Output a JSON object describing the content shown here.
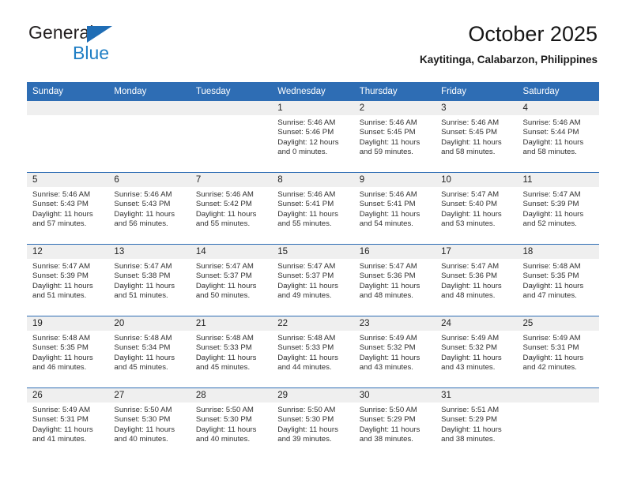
{
  "brand": {
    "name_part1": "General",
    "name_part2": "Blue",
    "triangle_icon": "blue-triangle-icon",
    "accent_color": "#1f7ec4"
  },
  "header": {
    "title": "October 2025",
    "subtitle": "Kaytitinga, Calabarzon, Philippines"
  },
  "theme": {
    "header_blue": "#2e6db4",
    "daynum_band": "#efefef",
    "text": "#222222"
  },
  "calendar": {
    "weekday_headers": [
      "Sunday",
      "Monday",
      "Tuesday",
      "Wednesday",
      "Thursday",
      "Friday",
      "Saturday"
    ],
    "weeks": [
      [
        {
          "day": "",
          "empty": true
        },
        {
          "day": "",
          "empty": true
        },
        {
          "day": "",
          "empty": true
        },
        {
          "day": "1",
          "sunrise": "Sunrise: 5:46 AM",
          "sunset": "Sunset: 5:46 PM",
          "daylight_1": "Daylight: 12 hours",
          "daylight_2": "and 0 minutes."
        },
        {
          "day": "2",
          "sunrise": "Sunrise: 5:46 AM",
          "sunset": "Sunset: 5:45 PM",
          "daylight_1": "Daylight: 11 hours",
          "daylight_2": "and 59 minutes."
        },
        {
          "day": "3",
          "sunrise": "Sunrise: 5:46 AM",
          "sunset": "Sunset: 5:45 PM",
          "daylight_1": "Daylight: 11 hours",
          "daylight_2": "and 58 minutes."
        },
        {
          "day": "4",
          "sunrise": "Sunrise: 5:46 AM",
          "sunset": "Sunset: 5:44 PM",
          "daylight_1": "Daylight: 11 hours",
          "daylight_2": "and 58 minutes."
        }
      ],
      [
        {
          "day": "5",
          "sunrise": "Sunrise: 5:46 AM",
          "sunset": "Sunset: 5:43 PM",
          "daylight_1": "Daylight: 11 hours",
          "daylight_2": "and 57 minutes."
        },
        {
          "day": "6",
          "sunrise": "Sunrise: 5:46 AM",
          "sunset": "Sunset: 5:43 PM",
          "daylight_1": "Daylight: 11 hours",
          "daylight_2": "and 56 minutes."
        },
        {
          "day": "7",
          "sunrise": "Sunrise: 5:46 AM",
          "sunset": "Sunset: 5:42 PM",
          "daylight_1": "Daylight: 11 hours",
          "daylight_2": "and 55 minutes."
        },
        {
          "day": "8",
          "sunrise": "Sunrise: 5:46 AM",
          "sunset": "Sunset: 5:41 PM",
          "daylight_1": "Daylight: 11 hours",
          "daylight_2": "and 55 minutes."
        },
        {
          "day": "9",
          "sunrise": "Sunrise: 5:46 AM",
          "sunset": "Sunset: 5:41 PM",
          "daylight_1": "Daylight: 11 hours",
          "daylight_2": "and 54 minutes."
        },
        {
          "day": "10",
          "sunrise": "Sunrise: 5:47 AM",
          "sunset": "Sunset: 5:40 PM",
          "daylight_1": "Daylight: 11 hours",
          "daylight_2": "and 53 minutes."
        },
        {
          "day": "11",
          "sunrise": "Sunrise: 5:47 AM",
          "sunset": "Sunset: 5:39 PM",
          "daylight_1": "Daylight: 11 hours",
          "daylight_2": "and 52 minutes."
        }
      ],
      [
        {
          "day": "12",
          "sunrise": "Sunrise: 5:47 AM",
          "sunset": "Sunset: 5:39 PM",
          "daylight_1": "Daylight: 11 hours",
          "daylight_2": "and 51 minutes."
        },
        {
          "day": "13",
          "sunrise": "Sunrise: 5:47 AM",
          "sunset": "Sunset: 5:38 PM",
          "daylight_1": "Daylight: 11 hours",
          "daylight_2": "and 51 minutes."
        },
        {
          "day": "14",
          "sunrise": "Sunrise: 5:47 AM",
          "sunset": "Sunset: 5:37 PM",
          "daylight_1": "Daylight: 11 hours",
          "daylight_2": "and 50 minutes."
        },
        {
          "day": "15",
          "sunrise": "Sunrise: 5:47 AM",
          "sunset": "Sunset: 5:37 PM",
          "daylight_1": "Daylight: 11 hours",
          "daylight_2": "and 49 minutes."
        },
        {
          "day": "16",
          "sunrise": "Sunrise: 5:47 AM",
          "sunset": "Sunset: 5:36 PM",
          "daylight_1": "Daylight: 11 hours",
          "daylight_2": "and 48 minutes."
        },
        {
          "day": "17",
          "sunrise": "Sunrise: 5:47 AM",
          "sunset": "Sunset: 5:36 PM",
          "daylight_1": "Daylight: 11 hours",
          "daylight_2": "and 48 minutes."
        },
        {
          "day": "18",
          "sunrise": "Sunrise: 5:48 AM",
          "sunset": "Sunset: 5:35 PM",
          "daylight_1": "Daylight: 11 hours",
          "daylight_2": "and 47 minutes."
        }
      ],
      [
        {
          "day": "19",
          "sunrise": "Sunrise: 5:48 AM",
          "sunset": "Sunset: 5:35 PM",
          "daylight_1": "Daylight: 11 hours",
          "daylight_2": "and 46 minutes."
        },
        {
          "day": "20",
          "sunrise": "Sunrise: 5:48 AM",
          "sunset": "Sunset: 5:34 PM",
          "daylight_1": "Daylight: 11 hours",
          "daylight_2": "and 45 minutes."
        },
        {
          "day": "21",
          "sunrise": "Sunrise: 5:48 AM",
          "sunset": "Sunset: 5:33 PM",
          "daylight_1": "Daylight: 11 hours",
          "daylight_2": "and 45 minutes."
        },
        {
          "day": "22",
          "sunrise": "Sunrise: 5:48 AM",
          "sunset": "Sunset: 5:33 PM",
          "daylight_1": "Daylight: 11 hours",
          "daylight_2": "and 44 minutes."
        },
        {
          "day": "23",
          "sunrise": "Sunrise: 5:49 AM",
          "sunset": "Sunset: 5:32 PM",
          "daylight_1": "Daylight: 11 hours",
          "daylight_2": "and 43 minutes."
        },
        {
          "day": "24",
          "sunrise": "Sunrise: 5:49 AM",
          "sunset": "Sunset: 5:32 PM",
          "daylight_1": "Daylight: 11 hours",
          "daylight_2": "and 43 minutes."
        },
        {
          "day": "25",
          "sunrise": "Sunrise: 5:49 AM",
          "sunset": "Sunset: 5:31 PM",
          "daylight_1": "Daylight: 11 hours",
          "daylight_2": "and 42 minutes."
        }
      ],
      [
        {
          "day": "26",
          "sunrise": "Sunrise: 5:49 AM",
          "sunset": "Sunset: 5:31 PM",
          "daylight_1": "Daylight: 11 hours",
          "daylight_2": "and 41 minutes."
        },
        {
          "day": "27",
          "sunrise": "Sunrise: 5:50 AM",
          "sunset": "Sunset: 5:30 PM",
          "daylight_1": "Daylight: 11 hours",
          "daylight_2": "and 40 minutes."
        },
        {
          "day": "28",
          "sunrise": "Sunrise: 5:50 AM",
          "sunset": "Sunset: 5:30 PM",
          "daylight_1": "Daylight: 11 hours",
          "daylight_2": "and 40 minutes."
        },
        {
          "day": "29",
          "sunrise": "Sunrise: 5:50 AM",
          "sunset": "Sunset: 5:30 PM",
          "daylight_1": "Daylight: 11 hours",
          "daylight_2": "and 39 minutes."
        },
        {
          "day": "30",
          "sunrise": "Sunrise: 5:50 AM",
          "sunset": "Sunset: 5:29 PM",
          "daylight_1": "Daylight: 11 hours",
          "daylight_2": "and 38 minutes."
        },
        {
          "day": "31",
          "sunrise": "Sunrise: 5:51 AM",
          "sunset": "Sunset: 5:29 PM",
          "daylight_1": "Daylight: 11 hours",
          "daylight_2": "and 38 minutes."
        },
        {
          "day": "",
          "empty": true
        }
      ]
    ]
  }
}
